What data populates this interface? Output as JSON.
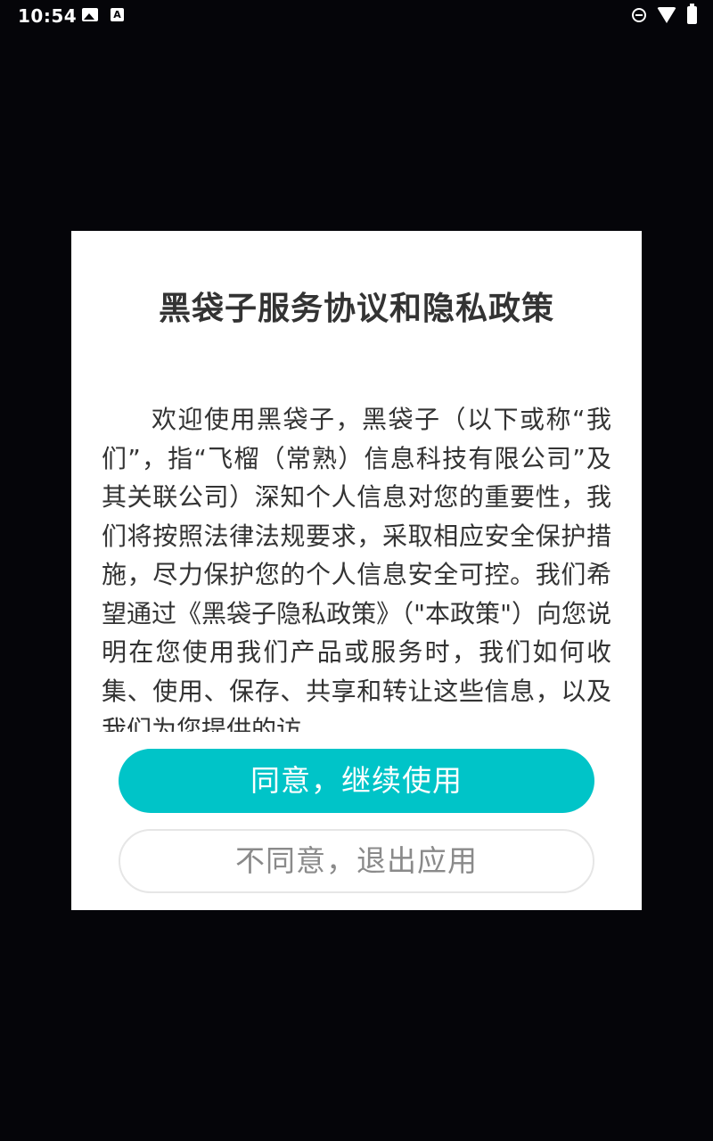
{
  "status_bar": {
    "time": "10:54",
    "icons": [
      "image-icon",
      "a-notification-icon",
      "do-not-disturb-icon",
      "wifi-icon",
      "battery-icon"
    ]
  },
  "dialog": {
    "title": "黑袋子服务协议和隐私政策",
    "body": "欢迎使用黑袋子，黑袋子（以下或称“我们”，指“飞榴（常熟）信息科技有限公司”及其关联公司）深知个人信息对您的重要性，我们将按照法律法规要求，采取相应安全保护措施，尽力保护您的个人信息安全可控。我们希望通过《黑袋子隐私政策》（\"本政策\"）向您说明在您使用我们产品或服务时，我们如何收集、使用、保存、共享和转让这些信息，以及我们为您提供的访",
    "agree_button": "同意，继续使用",
    "disagree_button": "不同意，退出应用"
  },
  "colors": {
    "backdrop": "#050509",
    "accent": "#00c4c8",
    "dialog_bg": "#ffffff",
    "text": "#333333",
    "secondary_text": "#8a8a8a"
  }
}
